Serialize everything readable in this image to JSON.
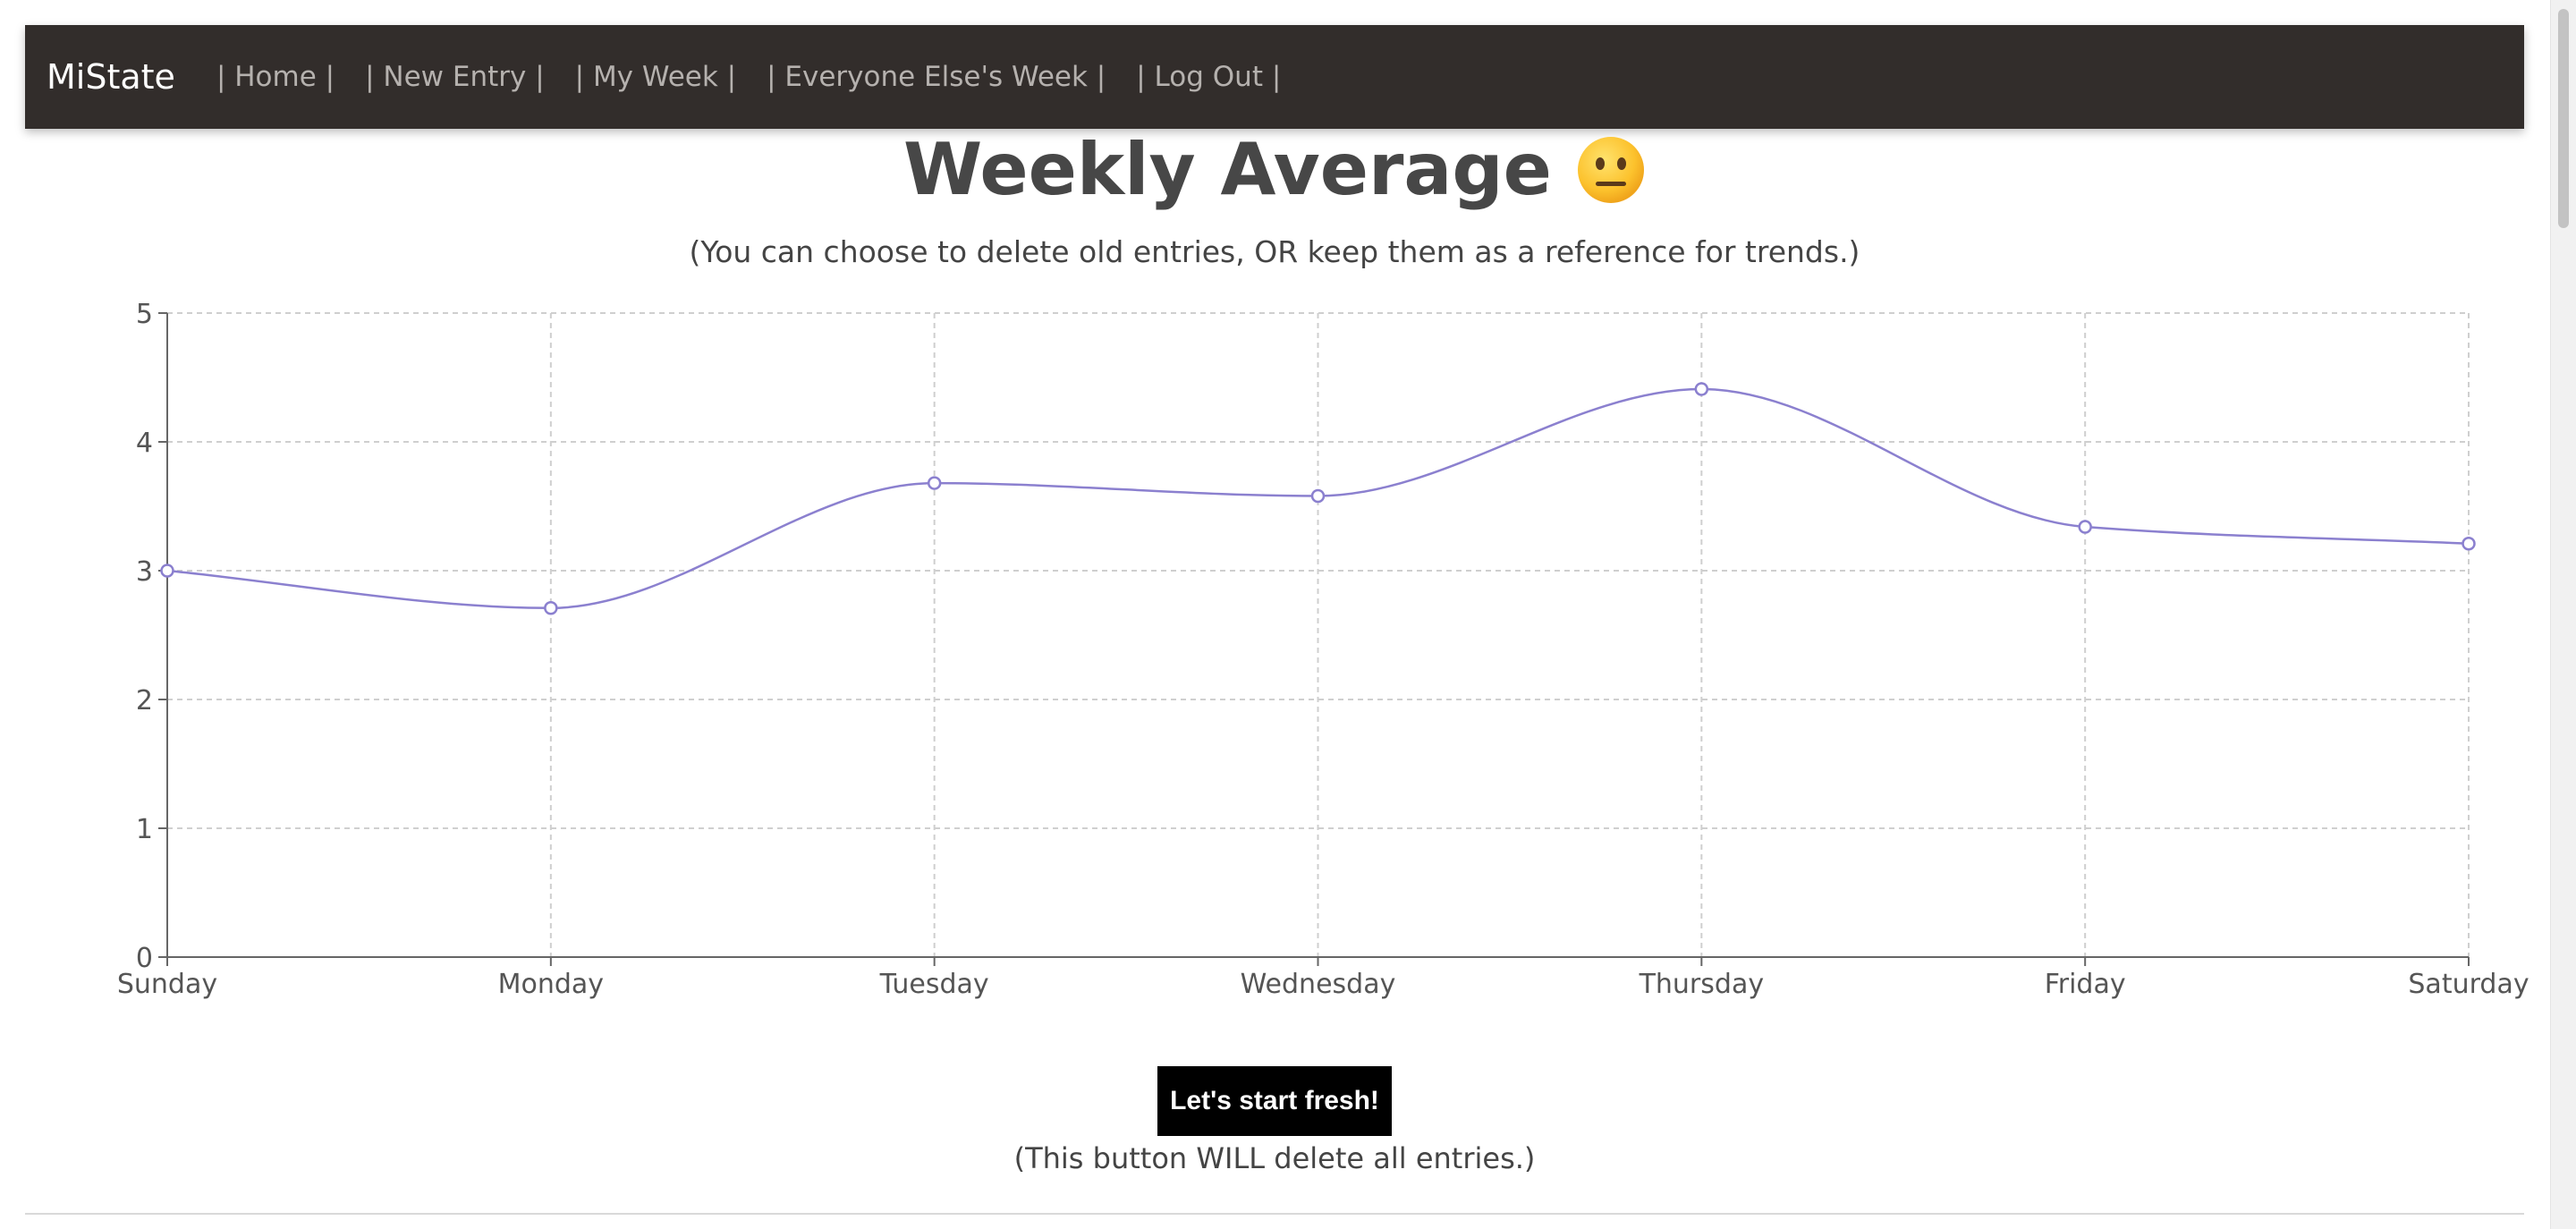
{
  "nav": {
    "brand": "MiState",
    "links": [
      "| Home |",
      "| New Entry |",
      "| My Week |",
      "| Everyone Else's Week |",
      "| Log Out |"
    ]
  },
  "header": {
    "title": "Weekly Average",
    "emoji_icon": "neutral-face-emoji",
    "subtitle": "(You can choose to delete old entries, OR keep them as a reference for trends.)"
  },
  "chart_data": {
    "type": "line",
    "categories": [
      "Sunday",
      "Monday",
      "Tuesday",
      "Wednesday",
      "Thursday",
      "Friday",
      "Saturday"
    ],
    "series": [
      {
        "values": [
          3.0,
          2.71,
          3.68,
          3.58,
          4.41,
          3.34,
          3.21
        ]
      }
    ],
    "ylim": [
      0,
      5
    ],
    "yticks": [
      0,
      1,
      2,
      3,
      4,
      5
    ],
    "grid": true,
    "line_color": "#8b80cf",
    "curve": "smooth"
  },
  "actions": {
    "reset_label": "Let's start fresh!",
    "reset_note": "(This button WILL delete all entries.)"
  },
  "colors": {
    "navbar_bg": "#322d2b",
    "button_bg": "#000000"
  }
}
